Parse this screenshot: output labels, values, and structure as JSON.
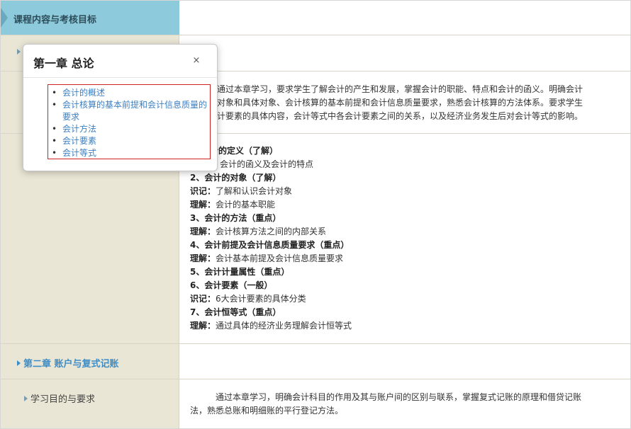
{
  "header": {
    "title": "课程内容与考核目标"
  },
  "chapter1": {
    "objective_paragraph": "通过本章学习，要求学生了解会计的产生和发展，掌握会计的职能、特点和会计的函义。明确会计对象和具体对象、会计核算的基本前提和会计信息质量要求，熟悉会计核算的方法体系。要求学生计要素的具体内容，会计等式中各会计要素之间的关系，以及经济业务发生后对会计等式的影响。",
    "objective_lines": [
      "通过本章学习，要求学生了解会计的产生和发展，掌握会计的职能、特点和会计的函义。明确会计",
      "对象和具体对象、会计核算的基本前提和会计信息质量要求，熟悉会计核算的方法体系。要求学生",
      "计要素的具体内容，会计等式中各会计要素之间的关系，以及经济业务发生后对会计等式的影响。"
    ],
    "outline": [
      {
        "bold": "计的定义（了解）",
        "text": ""
      },
      {
        "bold": "",
        "text": "会计的函义及会计的特点"
      },
      {
        "bold": "2、会计的对象（了解）",
        "text": ""
      },
      {
        "bold": "识记：",
        "text": "了解和认识会计对象"
      },
      {
        "bold": "理解：",
        "text": "会计的基本职能"
      },
      {
        "bold": "3、会计的方法（重点）",
        "text": ""
      },
      {
        "bold": "理解：",
        "text": "会计核算方法之间的内部关系"
      },
      {
        "bold": "4、会计前提及会计信息质量要求（重点）",
        "text": ""
      },
      {
        "bold": "理解：",
        "text": "会计基本前提及会计信息质量要求"
      },
      {
        "bold": "5、会计计量属性（重点）",
        "text": ""
      },
      {
        "bold": "6、会计要素（一般）",
        "text": ""
      },
      {
        "bold": "识记：",
        "text": "6大会计要素的具体分类"
      },
      {
        "bold": "7、会计恒等式（重点）",
        "text": ""
      },
      {
        "bold": "理解：",
        "text": "通过具体的经济业务理解会计恒等式"
      }
    ]
  },
  "chapter2": {
    "link_label": "第二章 账户与复式记账",
    "objective_label": "学习目的与要求",
    "objective_lines": [
      "通过本章学习，明确会计科目的作用及其与账户间的区别与联系，掌握复式记账的原理和借贷记账",
      "法，熟悉总账和明细账的平行登记方法。"
    ]
  },
  "popup": {
    "title": "第一章 总论",
    "close_label": "×",
    "items": [
      "会计的概述",
      "会计核算的基本前提和会计信息质量的要求",
      "会计方法",
      "会计要素",
      "会计等式"
    ]
  }
}
